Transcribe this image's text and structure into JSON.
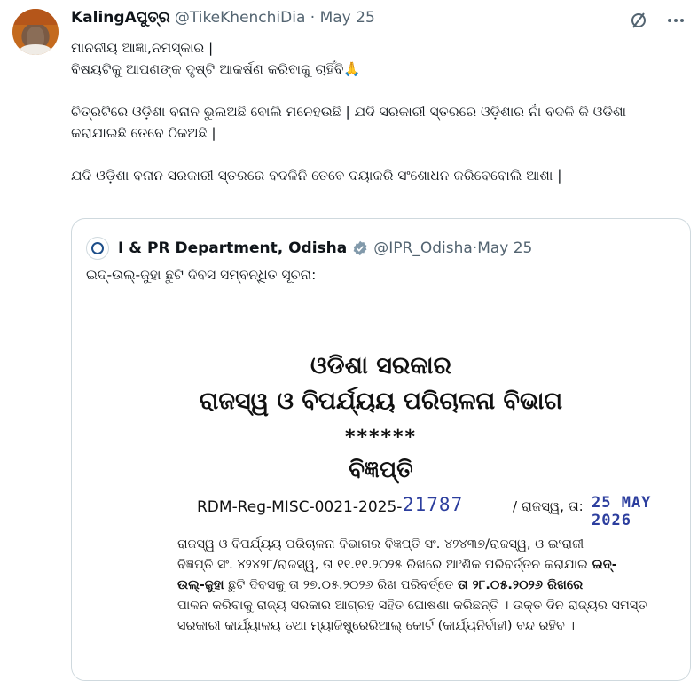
{
  "tweet": {
    "author_name": "KalingAପୁତ୍ର",
    "handle": "@TikeKhenchiDia",
    "separator": "·",
    "date": "May 25",
    "lines": [
      "ମାନନୀୟ ଆଜ୍ଞା,ନମସ୍କାର |",
      "ବିଷୟଟିକୁ ଆପଣଙ୍କ ଦୃଷ୍ଟି ଆକର୍ଷଣ କରିବାକୁ ଚାହିଁବି🙏",
      "ଚିତ୍ରଟିରେ ଓଡ଼ିଶା ବନାନ ଭୁଲଅଛି ବୋଲି ମନେହଉଛି | ଯଦି ସରକାରୀ ସ୍ତରରେ ଓଡ଼ିଶାର ନାଁ ବଦଳି କି ଓଡିଶା",
      "କରାଯାଇଛି ତେବେ ଠିକଅଛି |",
      "ଯଦି ଓଡ଼ିଶା ବନାନ ସରକାରୀ ସ୍ତରରେ ବଦଳିନି ତେବେ ଦୟାକରି ସଂଶୋଧନ କରିବେବୋଲି ଆଶା |"
    ]
  },
  "quote": {
    "author_name": "I & PR Department, Odisha",
    "handle": "@IPR_Odisha",
    "separator": "·",
    "date": "May 25",
    "text": "ଇଦ୍-ଉଲ୍-ଜୁହା ଛୁଟି ଦିବସ ସମ୍ବନ୍ଧିତ ସୂଚନା:",
    "document": {
      "title_line1": "ଓଡିଶା ସରକାର",
      "title_line2": "ରାଜସ୍ୱ ଓ ବିପର୍ଯ୍ୟୟ ପରିଚାଳନା ବିଭାଗ",
      "stars": "******",
      "title_line3": "ବିଜ୍ଞପ୍ତି",
      "ref_prefix": "RDM-Reg-MISC-0021-2025-",
      "ref_number": "21787",
      "ref_mid": "/ ରାଜସ୍ୱ, ତା:",
      "ref_date": "25 MAY 2026",
      "body": {
        "l1": "ରାଜସ୍ୱ ଓ ବିପର୍ଯ୍ୟୟ ପରିଚାଳନା ବିଭାଗର ବିଜ୍ଞପ୍ତି ସଂ. ୪୨୪୩୭/ରାଜସ୍ୱ, ଓ ଇଂରାଜୀ",
        "l2": "ବିଜ୍ଞପ୍ତି ସଂ. ୪୨୪୨୮/ରାଜସ୍ୱ, ତା ୧୧.୧୧.୨୦୨୫ ରିଖରେ ଆଂଶିକ ପରିବର୍ତ୍ତନ କରାଯାଇ ",
        "l2_bold": "ଇଦ୍-",
        "l3_bold": "ଉଲ୍-ଜୁହା",
        "l3": " ଛୁଟି ଦିବସକୁ ତା ୨୭.୦୫.୨୦୨୬ ରିଖ ପରିବର୍ତ୍ତେ ",
        "l3_bold2": "ତା ୨୮.୦୫.୨୦୨୬ ରିଖରେ",
        "l4": "ପାଳନ କରିବାକୁ ରାଜ୍ୟ ସରକାର ଆଗ୍ରହ ସହିତ ଘୋଷଣା କରିଛନ୍ତି । ଉକ୍ତ ଦିନ ରାଜ୍ୟର ସମସ୍ତ",
        "l5": "ସରକାରୀ କାର୍ଯ୍ୟାଳୟ ତଥା ମ୍ୟାଜିଷ୍ଟ୍ରେରିଆଲ୍ କୋର୍ଟ (କାର୍ଯ୍ୟନିର୍ବାହୀ) ବନ୍ଦ ରହିବ ।"
      }
    }
  },
  "icons": {
    "grok": "grok-icon",
    "more": "more-icon",
    "verified_color": "#829aab"
  }
}
